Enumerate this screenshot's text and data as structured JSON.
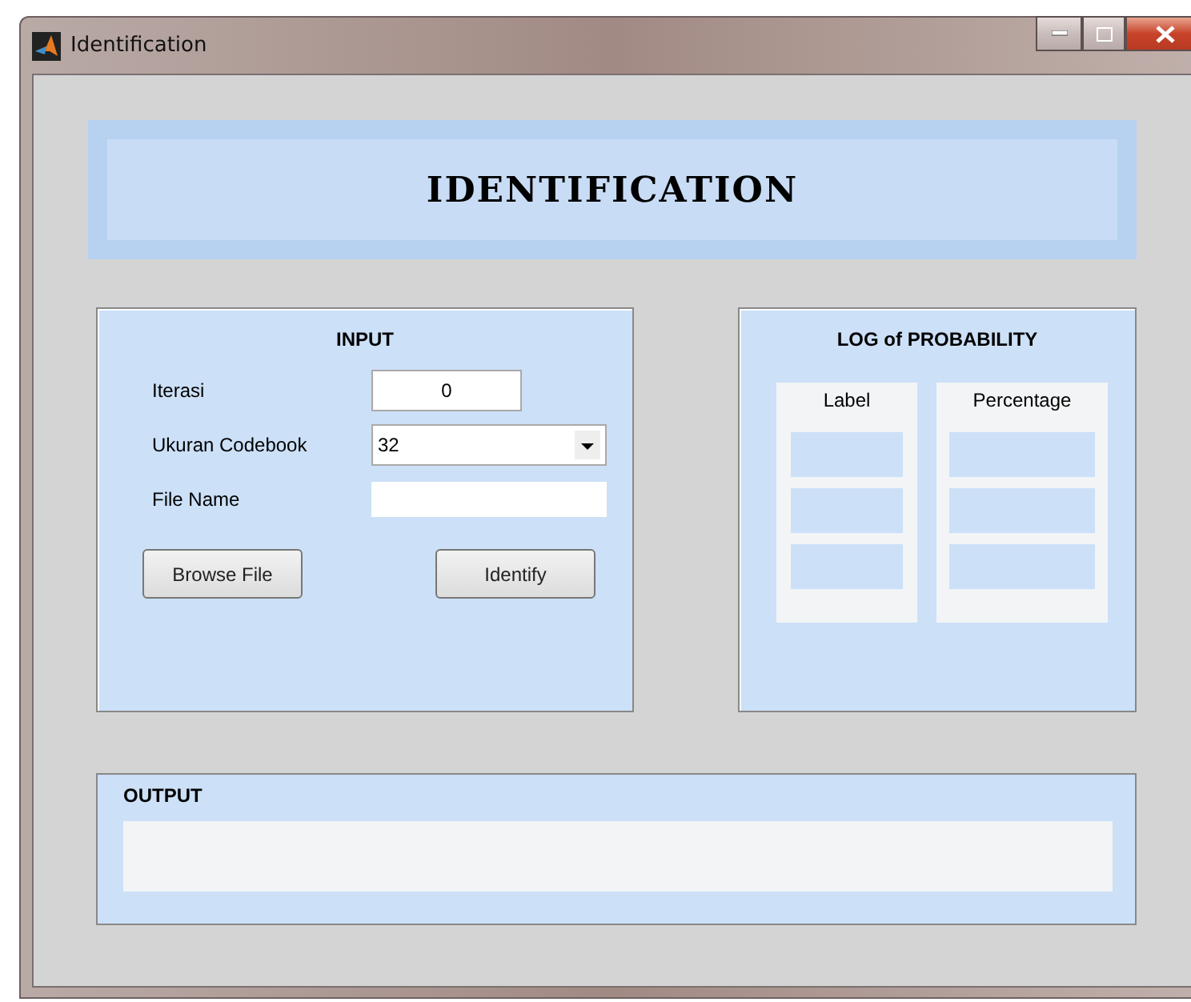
{
  "window": {
    "title": "Identification"
  },
  "banner": {
    "title": "IDENTIFICATION"
  },
  "input_panel": {
    "title": "INPUT",
    "iterasi": {
      "label": "Iterasi",
      "value": "0"
    },
    "codebook": {
      "label": "Ukuran Codebook",
      "value": "32"
    },
    "file_name": {
      "label": "File Name"
    },
    "buttons": [
      "Browse File",
      "Identify"
    ]
  },
  "log_panel": {
    "title": "LOG of PROBABILITY",
    "columns": [
      {
        "header": "Label"
      },
      {
        "header": "Percentage"
      }
    ]
  },
  "output_panel": {
    "title": "OUTPUT"
  }
}
